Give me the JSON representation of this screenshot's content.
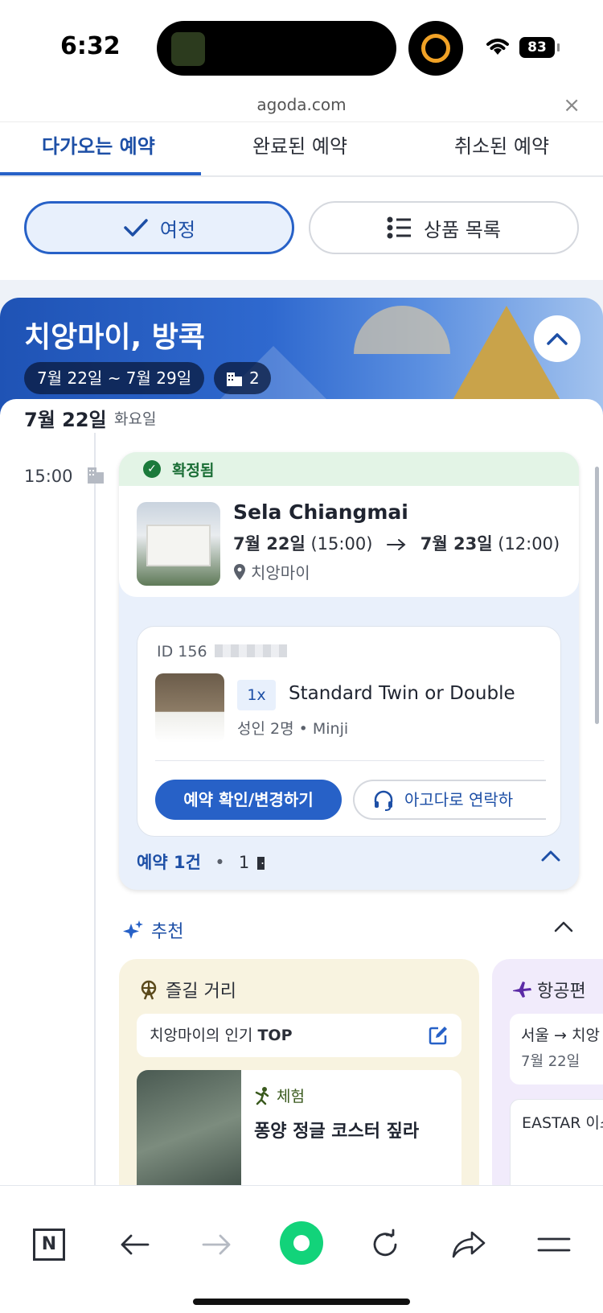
{
  "status_bar": {
    "time": "6:32",
    "battery": "83"
  },
  "browser": {
    "url": "agoda.com",
    "close_symbol": "×"
  },
  "tabs": [
    {
      "label": "다가오는 예약",
      "active": true
    },
    {
      "label": "완료된 예약",
      "active": false
    },
    {
      "label": "취소된 예약",
      "active": false
    }
  ],
  "view_toggle": {
    "itinerary_label": "여정",
    "product_list_label": "상품 목록"
  },
  "trip": {
    "title": "치앙마이, 방콕",
    "date_range": "7월 22일 ~ 7월 29일",
    "property_count": "2",
    "day_date": "7월 22일",
    "day_of_week": "화요일"
  },
  "booking": {
    "time": "15:00",
    "status": "확정됨",
    "hotel_name": "Sela Chiangmai",
    "checkin_date": "7월 22일",
    "checkin_time": "(15:00)",
    "checkout_date": "7월 23일",
    "checkout_time": "(12:00)",
    "location": "치앙마이",
    "id_label": "ID 156",
    "quantity": "1x",
    "room_name": "Standard Twin or Double",
    "guests": "성인 2명 • Minji",
    "primary_button": "예약 확인/변경하기",
    "contact_button": "아고다로 연락하",
    "footer_count": "예약 1건",
    "footer_sep": "•",
    "footer_rooms": "1"
  },
  "recommendations": {
    "header": "추천",
    "activities": {
      "title": "즐길 거리",
      "popular_prefix": "치앙마이의 인기 ",
      "popular_bold": "TOP",
      "category": "체험",
      "item_name": "퐁양 정글 코스터 짚라"
    },
    "flights": {
      "title": "항공편",
      "route": "서울 → 치앙",
      "date": "7월 22일",
      "airline": "EASTAR 이스트"
    }
  },
  "colors": {
    "accent": "#2761c7",
    "confirmed": "#1b7a3b",
    "brand_green": "#12d37a"
  }
}
